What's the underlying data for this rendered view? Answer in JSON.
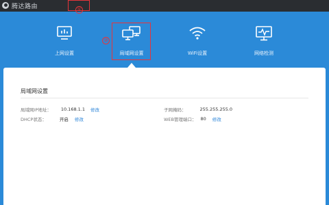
{
  "app": {
    "logo_text": "腾达路由",
    "top_links": [
      "",
      ""
    ]
  },
  "annotations": {
    "marker_1": "①",
    "marker_2": "②",
    "color": "#e8343a"
  },
  "nav": {
    "items": [
      {
        "label": "上网设置",
        "icon": "monitor-chart-icon"
      },
      {
        "label": "局域网设置",
        "icon": "lan-computers-icon",
        "selected": true
      },
      {
        "label": "WiFi设置",
        "icon": "wifi-icon"
      },
      {
        "label": "网络检测",
        "icon": "network-check-icon"
      }
    ]
  },
  "panel": {
    "title": "局域网设置",
    "lan_ip_label": "局域网IP地址：",
    "lan_ip_value": "10.168.1.1",
    "lan_ip_edit": "修改",
    "dhcp_label": "DHCP状态：",
    "dhcp_value": "开启",
    "dhcp_edit": "修改",
    "mask_label": "子网掩码：",
    "mask_value": "255.255.255.0",
    "web_port_label": "WEB管理端口：",
    "web_port_value": "80",
    "web_port_edit": "修改"
  },
  "colors": {
    "background": "#2b8ad8",
    "topbar": "#2a2d31",
    "link": "#2b84d8",
    "panel": "#ffffff"
  }
}
